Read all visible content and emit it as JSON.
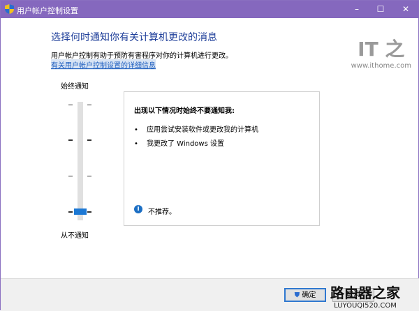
{
  "window": {
    "title": "用户帐户控制设置",
    "minimize": "–",
    "maximize": "☐",
    "close": "✕"
  },
  "heading": "选择何时通知你有关计算机更改的消息",
  "description": "用户帐户控制有助于预防有害程序对你的计算机进行更改。",
  "link": "有关用户帐户控制设置的详细信息",
  "slider": {
    "top_label": "始终通知",
    "bottom_label": "从不通知",
    "level": 0,
    "levels": 4
  },
  "panel": {
    "heading": "出现以下情况时始终不要通知我:",
    "items": [
      "应用尝试安装软件或更改我的计算机",
      "我更改了 Windows 设置"
    ],
    "note": "不推荐。",
    "bullet": "•",
    "info_icon": "i"
  },
  "buttons": {
    "ok": "确定",
    "cancel": "取消"
  },
  "watermarks": {
    "ithome_logo": "IT之家",
    "ithome_url": "www.ithome.com",
    "luyou_logo": "路由器之家",
    "luyou_url": "LUYOUQI520.COM"
  },
  "colors": {
    "titlebar": "#8568be",
    "accent": "#1c78d4"
  }
}
